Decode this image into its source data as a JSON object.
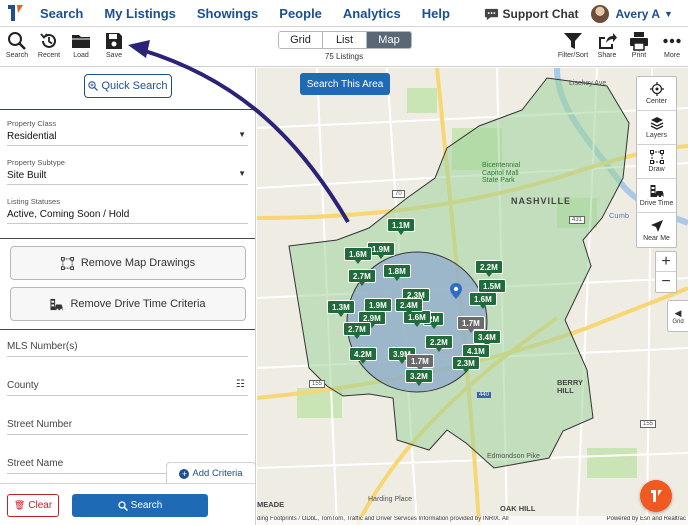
{
  "nav": {
    "items": [
      "Search",
      "My Listings",
      "Showings",
      "People",
      "Analytics",
      "Help"
    ],
    "support_label": "Support Chat",
    "user_name": "Avery A"
  },
  "toolbar": {
    "left": [
      "Search",
      "Recent",
      "Load",
      "Save"
    ],
    "views": [
      "Grid",
      "List",
      "Map"
    ],
    "active_view": "Map",
    "listing_count": "75 Listings",
    "right": [
      "Filter/Sort",
      "Share",
      "Print",
      "More"
    ]
  },
  "sidebar": {
    "quick_search": "Quick Search",
    "property_class": {
      "label": "Property Class",
      "value": "Residential"
    },
    "property_subtype": {
      "label": "Property Subtype",
      "value": "Site Built"
    },
    "listing_statuses": {
      "label": "Listing Statuses",
      "value": "Active, Coming Soon / Hold"
    },
    "remove_drawings": "Remove Map Drawings",
    "remove_drive": "Remove Drive Time Criteria",
    "mls_placeholder": "MLS Number(s)",
    "county_placeholder": "County",
    "street_number_placeholder": "Street Number",
    "street_name_placeholder": "Street Name",
    "add_criteria": "Add Criteria",
    "clear": "Clear",
    "search": "Search"
  },
  "map": {
    "search_area": "Search This Area",
    "tools": [
      "Center",
      "Layers",
      "Draw",
      "Drive Time",
      "Near Me"
    ],
    "zoom_in": "+",
    "zoom_out": "−",
    "grid_tab": "Grid",
    "labels": {
      "nashville": "NASHVILLE",
      "capitol": "Bicentennial\nCapitol Mall\nState Park",
      "berry_hill": "BERRY\nHILL",
      "oak_hill": "OAK HILL",
      "meade": "MEADE",
      "harding": "Harding Place",
      "edmondson": "Edmondson Pike",
      "lischey": "Lischey Ave",
      "cumb": "Cumb",
      "r155a": "155",
      "r155b": "155",
      "r440": "440",
      "r431": "431",
      "r70": "70"
    },
    "pins": [
      {
        "label": "1.1M",
        "gray": false
      },
      {
        "label": "1.9M",
        "gray": false
      },
      {
        "label": "1.6M",
        "gray": false
      },
      {
        "label": "2.7M",
        "gray": false
      },
      {
        "label": "1.8M",
        "gray": false
      },
      {
        "label": "2.2M",
        "gray": false
      },
      {
        "label": "1.5M",
        "gray": false
      },
      {
        "label": "2.3M",
        "gray": false
      },
      {
        "label": "1.6M",
        "gray": false
      },
      {
        "label": "1.9M",
        "gray": false
      },
      {
        "label": "2.9M",
        "gray": false
      },
      {
        "label": "2.7M",
        "gray": false
      },
      {
        "label": "2M",
        "gray": false
      },
      {
        "label": "1.7M",
        "gray": true
      },
      {
        "label": "3.4M",
        "gray": false
      },
      {
        "label": "2.2M",
        "gray": false
      },
      {
        "label": "4.2M",
        "gray": false
      },
      {
        "label": "3.9M",
        "gray": false
      },
      {
        "label": "1.7M",
        "gray": true
      },
      {
        "label": "4.1M",
        "gray": false
      },
      {
        "label": "2.3M",
        "gray": false
      },
      {
        "label": "3.2M",
        "gray": false
      },
      {
        "label": "1.3M",
        "gray": false
      },
      {
        "label": "1.6M",
        "gray": false
      },
      {
        "label": "2.4M",
        "gray": false
      }
    ],
    "attribution_left": "ding Footprints / ODbL, TomTom, Traffic and Driver Services Information provided by INRIX. All",
    "attribution_right": "Powered by Esri and Realtrac"
  },
  "colors": {
    "brand_blue": "#1d4f91",
    "button_blue": "#1f6ab5",
    "pin_green": "#1f6b3a",
    "pin_gray": "#6a6a6a",
    "polygon_fill": "#9ed39a",
    "circle_fill": "#8aa6cf",
    "fab_orange": "#f05a22",
    "arrow_navy": "#2b2378"
  },
  "icons": [
    "logo-icon",
    "chat-icon",
    "search-icon",
    "recent-icon",
    "folder-icon",
    "save-icon",
    "filter-icon",
    "share-icon",
    "print-icon",
    "more-icon",
    "center-icon",
    "layers-icon",
    "draw-icon",
    "drive-time-icon",
    "near-me-icon",
    "map-pin-icon",
    "trash-icon"
  ]
}
